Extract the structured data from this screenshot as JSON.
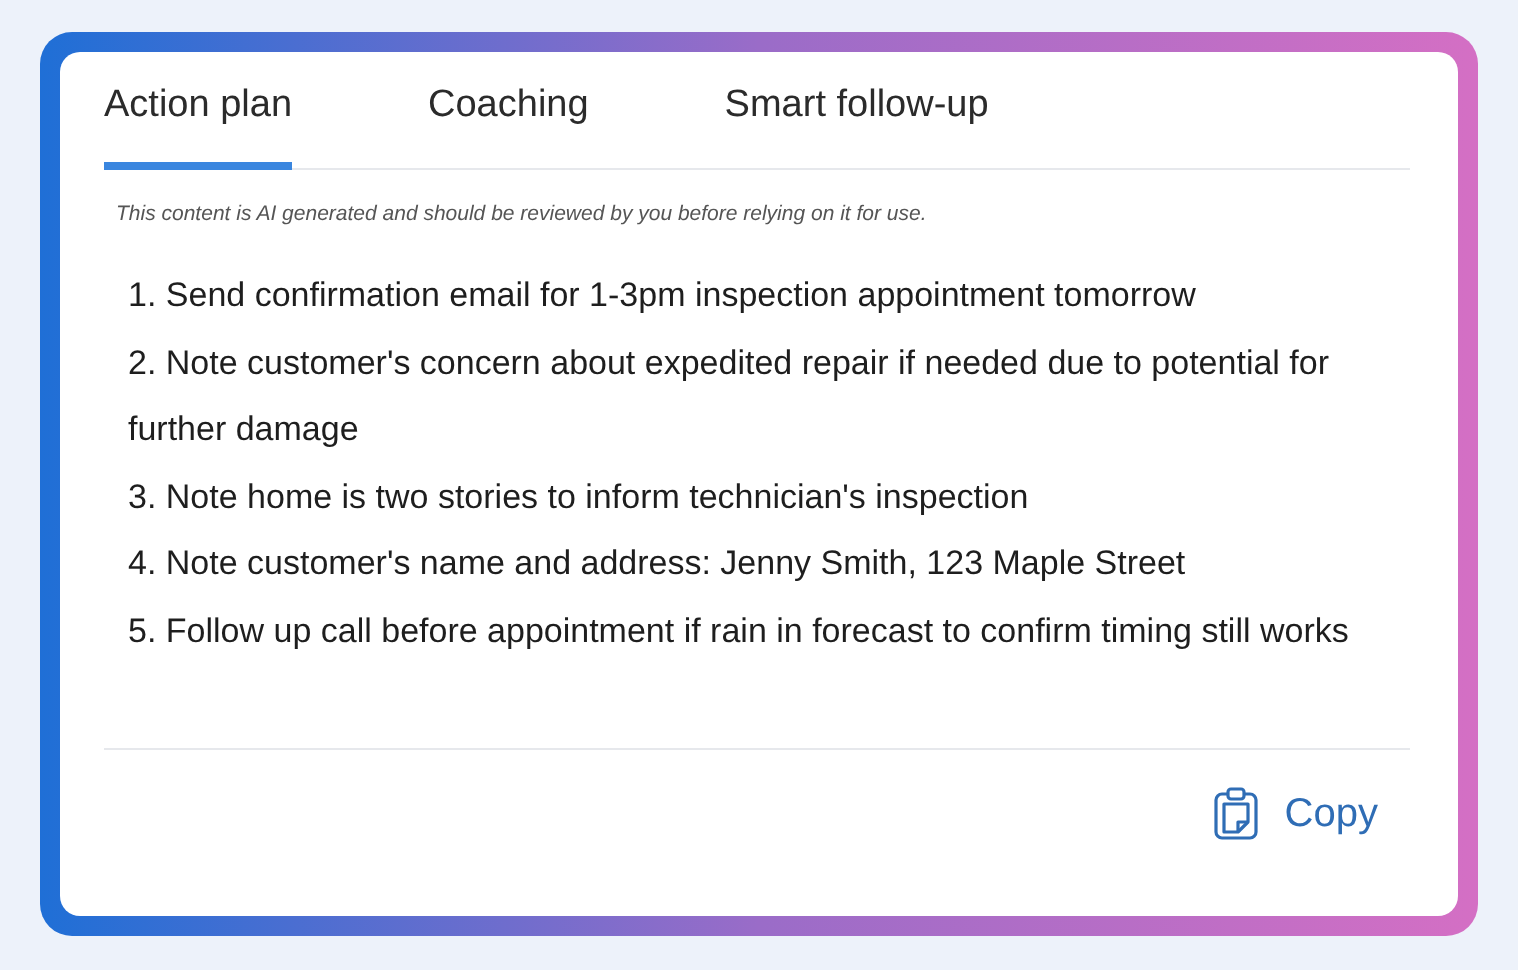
{
  "tabs": [
    {
      "label": "Action plan",
      "selected": true
    },
    {
      "label": "Coaching",
      "selected": false
    },
    {
      "label": "Smart follow-up",
      "selected": false
    }
  ],
  "disclaimer": "This content is AI generated and should be reviewed by you before relying on it for use.",
  "items": [
    "1. Send confirmation email for 1-3pm inspection appointment tomorrow",
    "2. Note customer's concern about expedited repair if needed due to potential for further damage",
    "3. Note home is two stories to inform technician's inspection",
    "4. Note customer's name and address: Jenny Smith, 123 Maple Street",
    "5. Follow up call before appointment if rain in forecast to confirm timing still works"
  ],
  "copy_button": {
    "label": "Copy"
  }
}
